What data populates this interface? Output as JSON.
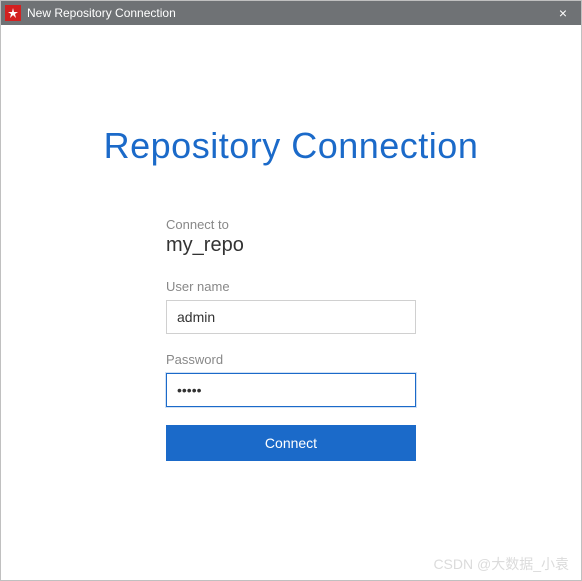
{
  "window": {
    "title": "New Repository Connection",
    "close_symbol": "×"
  },
  "heading": "Repository Connection",
  "form": {
    "connect_to_label": "Connect to",
    "repo_name": "my_repo",
    "username_label": "User name",
    "username_value": "admin",
    "password_label": "Password",
    "password_value": "•••••",
    "connect_button": "Connect"
  },
  "watermark": "CSDN @大数据_小袁"
}
